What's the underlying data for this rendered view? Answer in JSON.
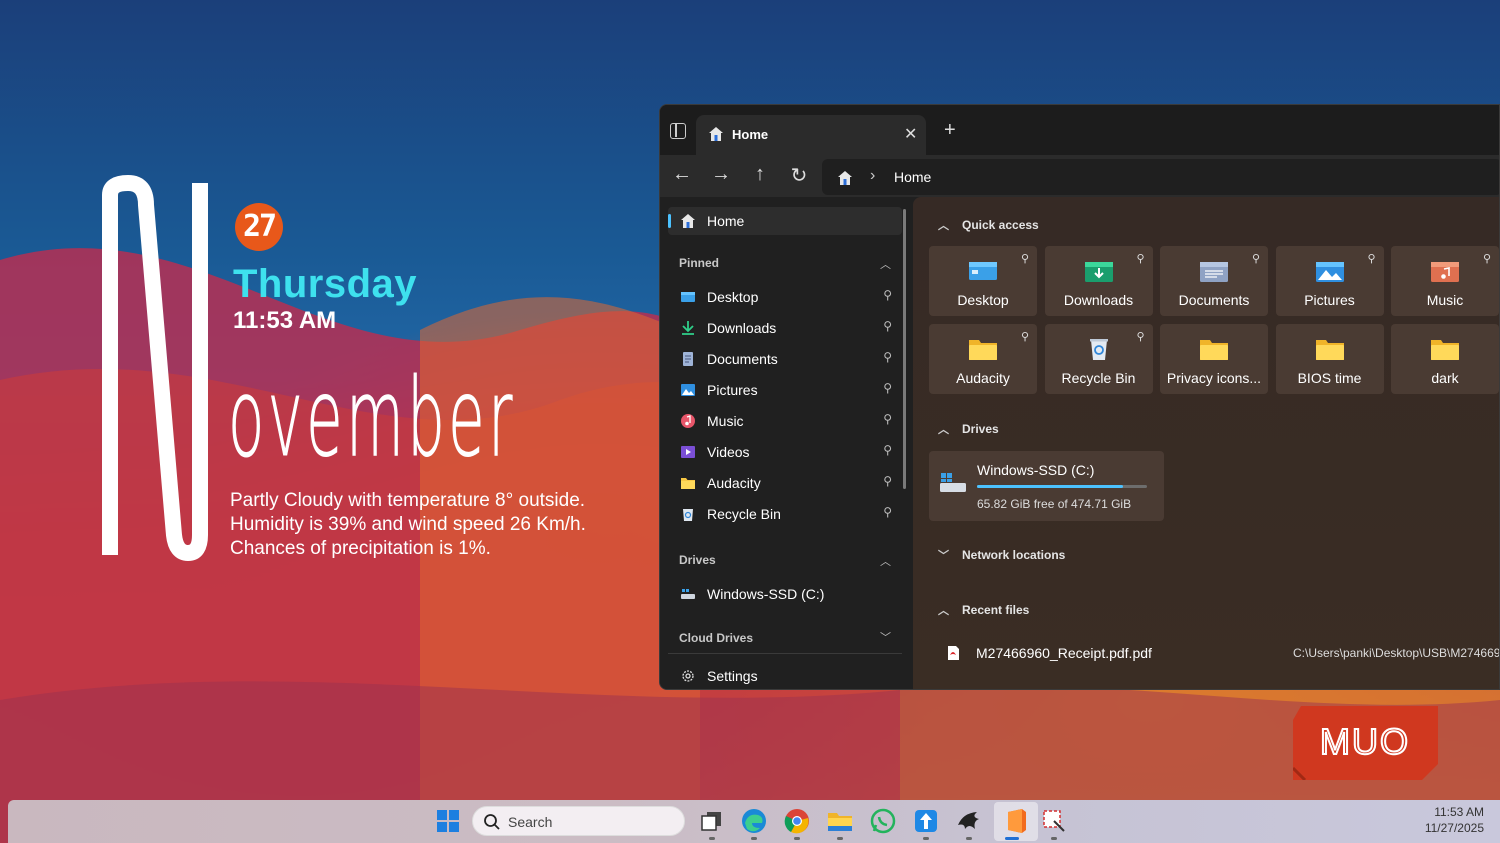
{
  "widget": {
    "day": "27",
    "weekday": "Thursday",
    "time": "11:53 AM",
    "month_initial": "N",
    "month_rest": "ovember",
    "weather_lines": [
      "Partly Cloudy with temperature 8° outside.",
      "Humidity is 39% and wind speed 26 Km/h.",
      "Chances of precipitation is 1%."
    ]
  },
  "explorer": {
    "tab_title": "Home",
    "address": {
      "crumb": "Home"
    },
    "sidebar": {
      "home_label": "Home",
      "pinned_header": "Pinned",
      "pinned": [
        {
          "label": "Desktop",
          "icon": "desktop-icon"
        },
        {
          "label": "Downloads",
          "icon": "download-icon"
        },
        {
          "label": "Documents",
          "icon": "document-icon"
        },
        {
          "label": "Pictures",
          "icon": "pictures-icon"
        },
        {
          "label": "Music",
          "icon": "music-icon"
        },
        {
          "label": "Videos",
          "icon": "videos-icon"
        },
        {
          "label": "Audacity",
          "icon": "folder-icon"
        },
        {
          "label": "Recycle Bin",
          "icon": "recycle-bin-icon"
        }
      ],
      "drives_header": "Drives",
      "drive_item": "Windows-SSD (C:)",
      "cloud_header": "Cloud Drives",
      "settings_label": "Settings"
    },
    "quick_access": {
      "header": "Quick access",
      "tiles": [
        {
          "label": "Desktop",
          "pinned": true
        },
        {
          "label": "Downloads",
          "pinned": true
        },
        {
          "label": "Documents",
          "pinned": true
        },
        {
          "label": "Pictures",
          "pinned": true
        },
        {
          "label": "Music",
          "pinned": true
        },
        {
          "label": "Audacity",
          "pinned": true
        },
        {
          "label": "Recycle Bin",
          "pinned": true
        },
        {
          "label": "Privacy icons...",
          "pinned": false
        },
        {
          "label": "BIOS time",
          "pinned": false
        },
        {
          "label": "dark",
          "pinned": false
        }
      ]
    },
    "drives": {
      "header": "Drives",
      "name": "Windows-SSD (C:)",
      "free_text": "65.82 GiB free of 474.71 GiB",
      "used_fraction": 0.861
    },
    "network": {
      "header": "Network locations"
    },
    "recent": {
      "header": "Recent files",
      "files": [
        {
          "name": "M27466960_Receipt.pdf.pdf",
          "path": "C:\\Users\\panki\\Desktop\\USB\\M274669"
        }
      ]
    }
  },
  "branding": {
    "logo_text": "MUO"
  },
  "taskbar": {
    "search_placeholder": "Search",
    "time": "11:53 AM",
    "date": "11/27/2025",
    "apps": [
      "start-icon",
      "task-view-icon",
      "edge-icon",
      "chrome-icon",
      "file-explorer-icon",
      "whatsapp-icon",
      "app-icon",
      "terminal-icon",
      "office-icon",
      "snipping-tool-icon"
    ]
  },
  "colors": {
    "accent": "#4cc2ff",
    "weekday": "#3ee1ee",
    "day_badge": "#e8581a",
    "muo": "#d0381f"
  }
}
